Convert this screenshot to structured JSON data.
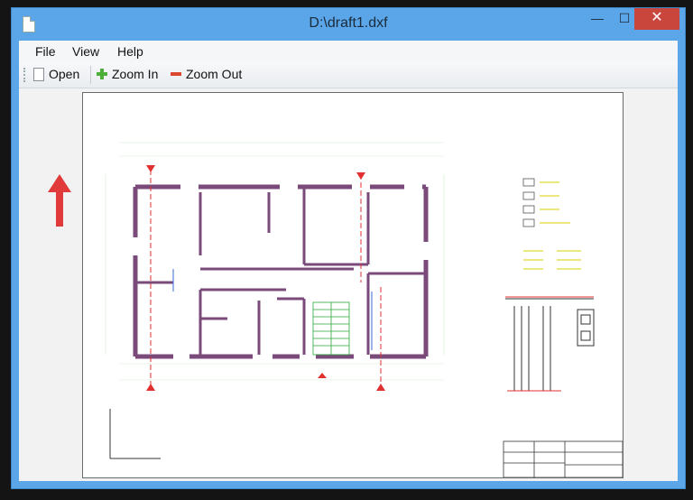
{
  "window": {
    "title": "D:\\draft1.dxf"
  },
  "menu": {
    "file": "File",
    "view": "View",
    "help": "Help"
  },
  "toolbar": {
    "open": "Open",
    "zoom_in": "Zoom In",
    "zoom_out": "Zoom Out"
  },
  "icons": {
    "open": "document-icon",
    "zoom_in": "plus-icon",
    "zoom_out": "minus-icon"
  },
  "colors": {
    "titlebar": "#5aa6e8",
    "close": "#c9463d",
    "annotation_arrow": "#e03a3a",
    "drawing_walls": "#7a4a7a",
    "drawing_red": "#e03030",
    "drawing_green": "#2aa83a",
    "drawing_yellow": "#d8d000"
  }
}
